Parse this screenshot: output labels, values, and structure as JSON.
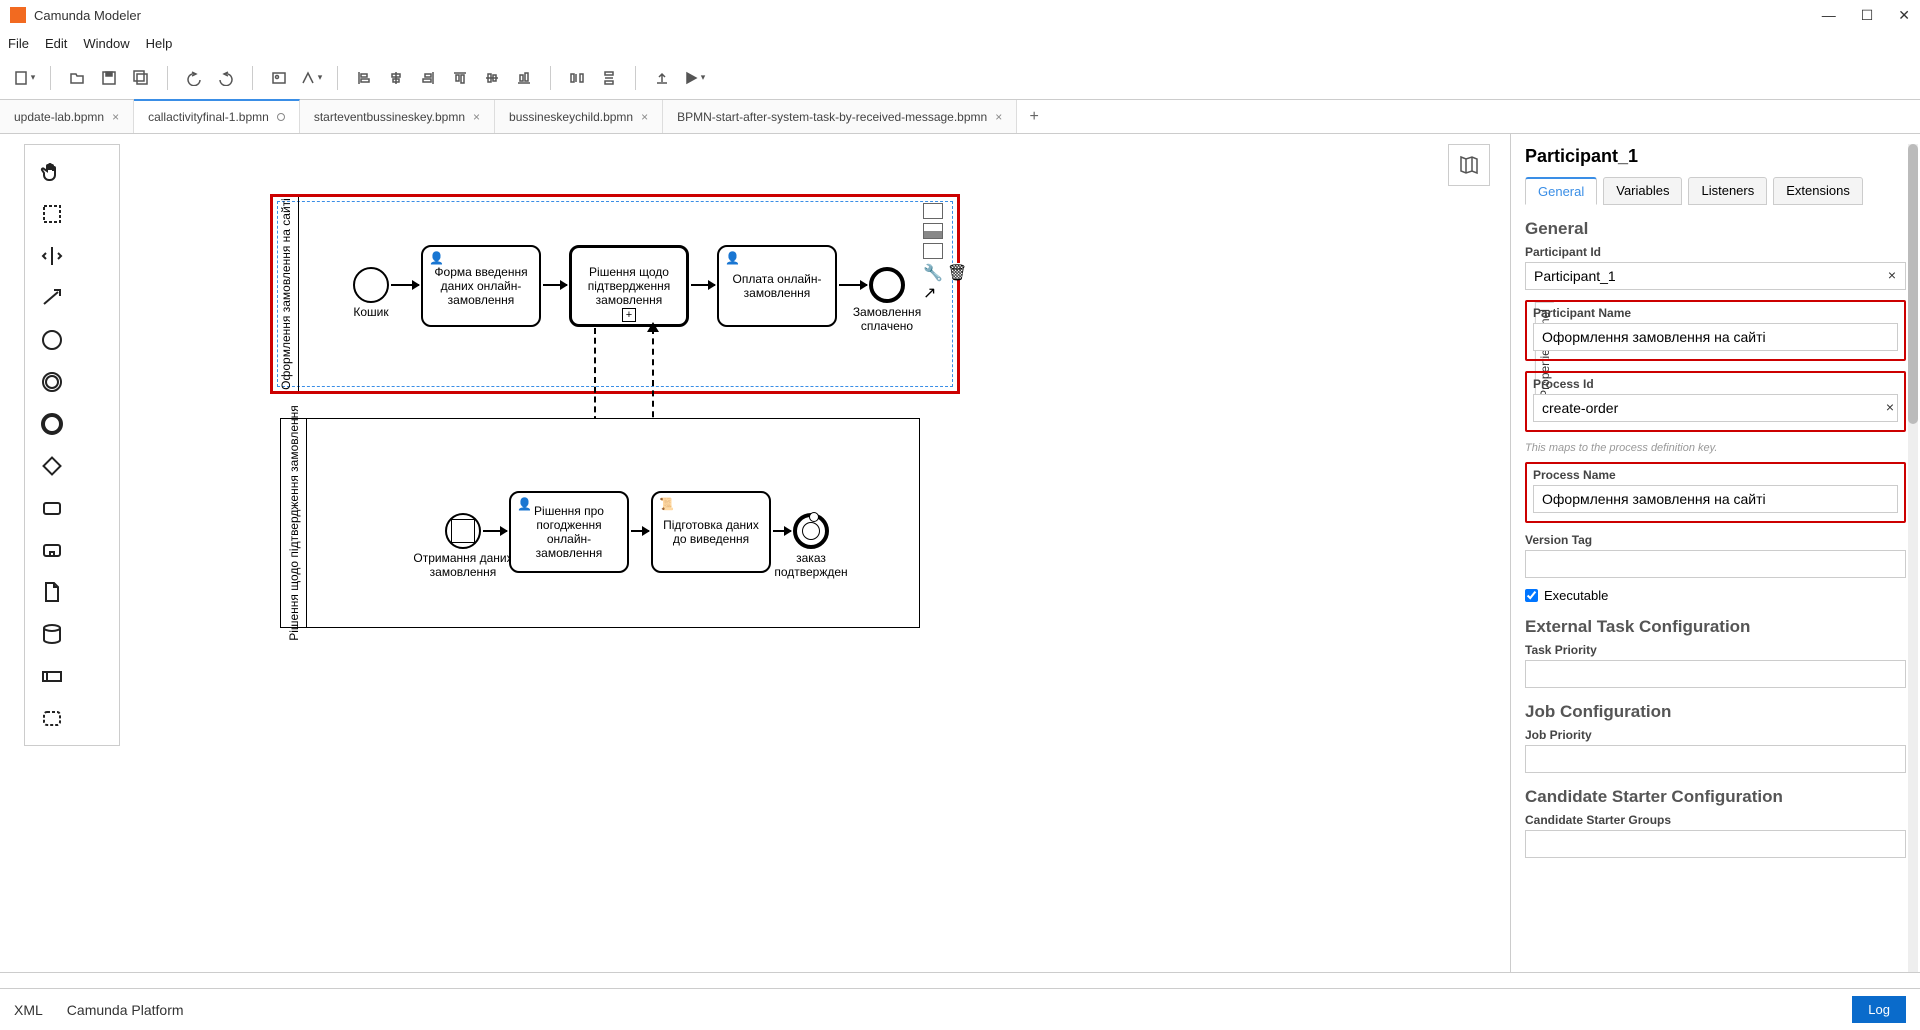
{
  "window": {
    "title": "Camunda Modeler"
  },
  "menu": {
    "file": "File",
    "edit": "Edit",
    "window": "Window",
    "help": "Help"
  },
  "tabs": [
    {
      "label": "update-lab.bpmn",
      "active": false,
      "dirty": false
    },
    {
      "label": "callactivityfinal-1.bpmn",
      "active": true,
      "dirty": true
    },
    {
      "label": "starteventbussineskey.bpmn",
      "active": false,
      "dirty": false
    },
    {
      "label": "bussineskeychild.bpmn",
      "active": false,
      "dirty": false
    },
    {
      "label": "BPMN-start-after-system-task-by-received-message.bpmn",
      "active": false,
      "dirty": false
    }
  ],
  "pool1": {
    "label": "Оформлення замовлення на сайті",
    "start_label": "Кошик",
    "task1": "Форма введення даних онлайн-замовлення",
    "task2": "Рішення щодо підтвердження замовлення",
    "task3": "Оплата онлайн-замовлення",
    "end_label": "Замовлення сплачено"
  },
  "pool2": {
    "label": "Рішення щодо підтвердження замовлення",
    "start_label": "Отримання даних замовлення",
    "task1": "Рішення про погодження онлайн-замовлення",
    "task2": "Підготовка даних до виведення",
    "end_label": "заказ подтвержден"
  },
  "props": {
    "title": "Participant_1",
    "tabs": {
      "general": "General",
      "variables": "Variables",
      "listeners": "Listeners",
      "extensions": "Extensions"
    },
    "section_general": "General",
    "participant_id_label": "Participant Id",
    "participant_id_value": "Participant_1",
    "participant_name_label": "Participant Name",
    "participant_name_value": "Оформлення замовлення на сайті",
    "process_id_label": "Process Id",
    "process_id_value": "create-order",
    "process_id_hint": "This maps to the process definition key.",
    "process_name_label": "Process Name",
    "process_name_value": "Оформлення замовлення на сайті",
    "version_tag_label": "Version Tag",
    "version_tag_value": "",
    "executable_label": "Executable",
    "section_external": "External Task Configuration",
    "task_priority_label": "Task Priority",
    "section_job": "Job Configuration",
    "job_priority_label": "Job Priority",
    "section_candidate": "Candidate Starter Configuration",
    "candidate_groups_label": "Candidate Starter Groups",
    "panel_label": "Properties Panel"
  },
  "statusbar": {
    "xml": "XML",
    "platform": "Camunda Platform",
    "log": "Log"
  }
}
